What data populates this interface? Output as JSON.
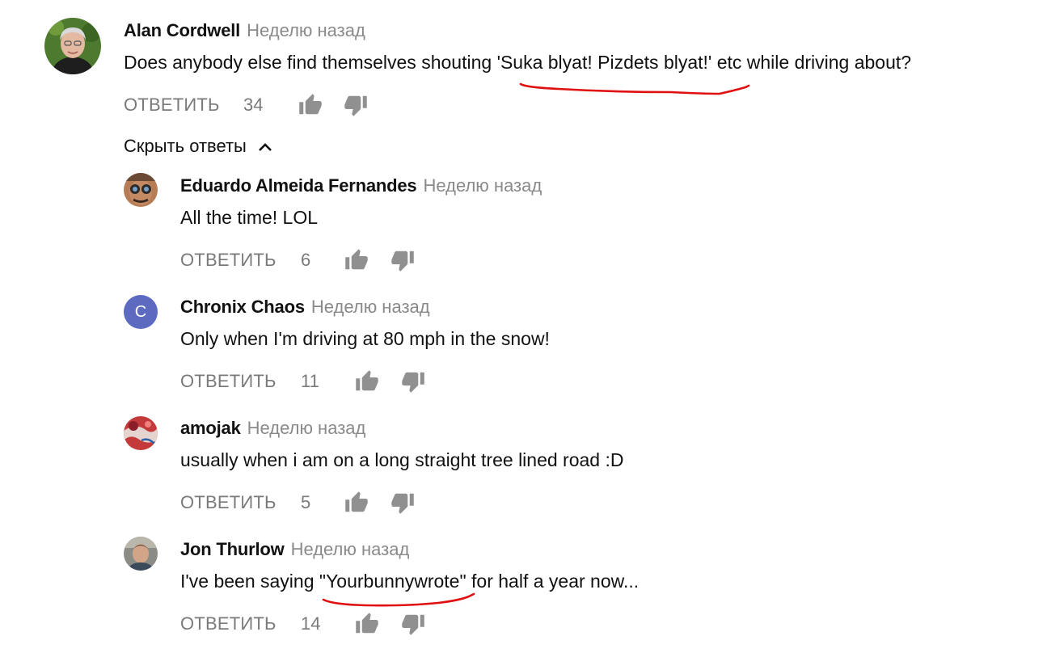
{
  "ui": {
    "reply_label": "ОТВЕТИТЬ",
    "hide_replies_label": "Скрыть ответы",
    "annotation_color": "#e01010",
    "time_color": "#8a8a8a",
    "action_color": "#7a7a7a"
  },
  "comments": [
    {
      "author": "Alan Cordwell",
      "time": "Неделю назад",
      "text_before": "Does anybody else find themselves shouting ",
      "text_highlight": "'Suka blyat! Pizdets blyat!'",
      "text_after": " etc while driving about?",
      "likes": "34",
      "avatar_icon": "photo-gray-haired-man"
    }
  ],
  "replies": [
    {
      "author": "Eduardo Almeida Fernandes",
      "time": "Неделю назад",
      "text": "All the time! LOL",
      "likes": "6",
      "avatar_icon": "photo-man-with-goggles"
    },
    {
      "author": "Chronix Chaos",
      "time": "Неделю назад",
      "text": "Only when I'm driving at 80 mph in the snow!",
      "likes": "11",
      "avatar_letter": "C",
      "avatar_color": "#5c6bc0"
    },
    {
      "author": "amojak",
      "time": "Неделю назад",
      "text": "usually when i am on a long straight tree lined road :D",
      "likes": "5",
      "avatar_icon": "photo-red-abstract"
    },
    {
      "author": "Jon Thurlow",
      "time": "Неделю назад",
      "text_before": "I've been saying ",
      "text_highlight": "\"Yourbunnywrote\"",
      "text_after": " for half a year now...",
      "likes": "14",
      "avatar_icon": "photo-man-portrait"
    }
  ]
}
